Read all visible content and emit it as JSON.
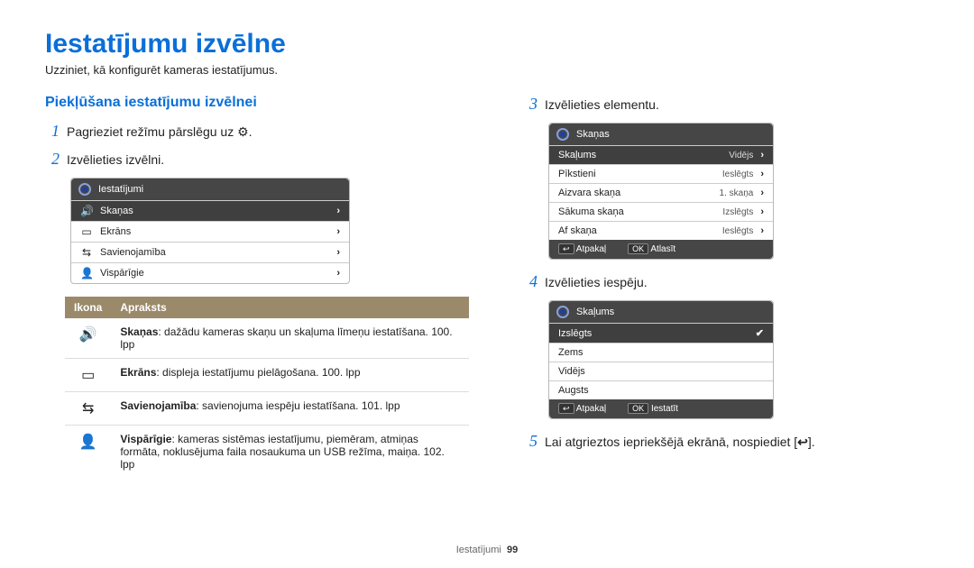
{
  "title": "Iestatījumu izvēlne",
  "subtitle": "Uzziniet, kā konfigurēt kameras iestatījumus.",
  "section_heading": "Piekļūšana iestatījumu izvēlnei",
  "steps": {
    "s1": "Pagrieziet režīmu pārslēgu uz ",
    "s1_icon": "⚙",
    "s1_end": ".",
    "s2": "Izvēlieties izvēlni.",
    "s3": "Izvēlieties elementu.",
    "s4": "Izvēlieties iespēju.",
    "s5_a": "Lai atgrieztos iepriekšējā ekrānā, nospiediet [",
    "s5_icon": "↩",
    "s5_b": "]."
  },
  "panelA": {
    "title": "Iestatījumi",
    "rows": [
      {
        "icon": "🔊",
        "label": "Skaņas"
      },
      {
        "icon": "▭",
        "label": "Ekrāns"
      },
      {
        "icon": "⇆",
        "label": "Savienojamība"
      },
      {
        "icon": "👤",
        "label": "Vispārīgie"
      }
    ]
  },
  "panelB": {
    "title": "Skaņas",
    "rows": [
      {
        "label": "Skaļums",
        "value": "Vidējs"
      },
      {
        "label": "Pīkstieni",
        "value": "Ieslēgts"
      },
      {
        "label": "Aizvara skaņa",
        "value": "1. skaņa"
      },
      {
        "label": "Sākuma skaņa",
        "value": "Izslēgts"
      },
      {
        "label": "Af skaņa",
        "value": "Ieslēgts"
      }
    ],
    "back_label": "Atpakaļ",
    "ok_label": "Atlasīt",
    "back_btn": "↩",
    "ok_btn": "OK"
  },
  "panelC": {
    "title": "Skaļums",
    "rows": [
      "Izslēgts",
      "Zems",
      "Vidējs",
      "Augsts"
    ],
    "selected_index": 0,
    "back_label": "Atpakaļ",
    "ok_label": "Iestatīt",
    "back_btn": "↩",
    "ok_btn": "OK"
  },
  "desc_header": {
    "icon": "Ikona",
    "desc": "Apraksts"
  },
  "desc_rows": [
    {
      "icon": "🔊",
      "bold": "Skaņas",
      "text": ": dažādu kameras skaņu un skaļuma līmeņu iestatīšana. 100. lpp"
    },
    {
      "icon": "▭",
      "bold": "Ekrāns",
      "text": ": displeja iestatījumu pielāgošana. 100. lpp"
    },
    {
      "icon": "⇆",
      "bold": "Savienojamība",
      "text": ": savienojuma iespēju iestatīšana. 101. lpp"
    },
    {
      "icon": "👤",
      "bold": "Vispārīgie",
      "text": ": kameras sistēmas iestatījumu, piemēram, atmiņas formāta, noklusējuma faila nosaukuma un USB režīma, maiņa. 102. lpp"
    }
  ],
  "footer": {
    "section": "Iestatījumi",
    "page": "99"
  }
}
